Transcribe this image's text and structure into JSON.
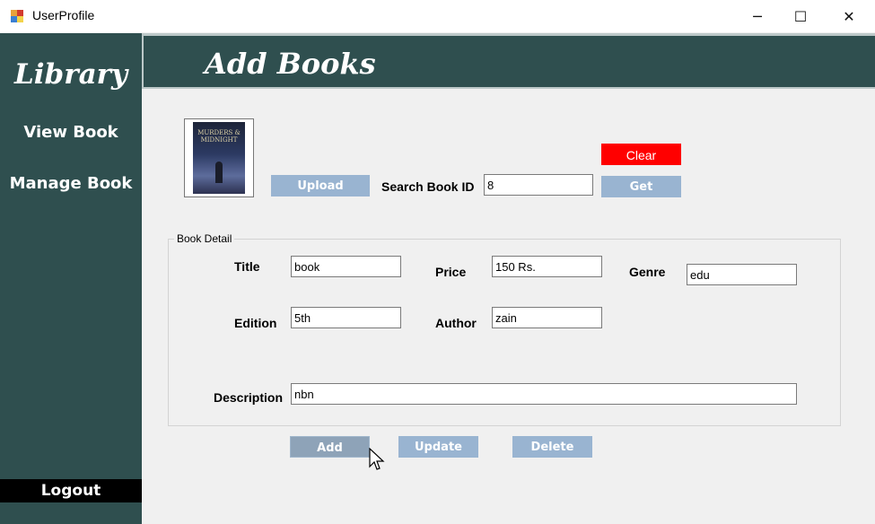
{
  "window": {
    "title": "UserProfile",
    "minimize_glyph": "─",
    "maximize_glyph": "☐",
    "close_glyph": "✕"
  },
  "sidebar": {
    "brand": "Library",
    "items": [
      {
        "label": "View Book"
      },
      {
        "label": "Manage Book"
      }
    ],
    "logout": "Logout",
    "bg_color": "#2f4f4f"
  },
  "header": {
    "title": "Add Books"
  },
  "cover": {
    "title_text": "MURDERS & MIDNIGHT"
  },
  "upload_button": "Upload",
  "search": {
    "label": "Search Book ID",
    "value": "8"
  },
  "clear_button": "Clear",
  "get_button": "Get",
  "book_detail": {
    "legend": "Book Detail",
    "title": {
      "label": "Title",
      "value": "book"
    },
    "price": {
      "label": "Price",
      "value": "150 Rs."
    },
    "genre": {
      "label": "Genre",
      "value": "edu"
    },
    "edition": {
      "label": "Edition",
      "value": "5th"
    },
    "author": {
      "label": "Author",
      "value": "zain"
    },
    "description": {
      "label": "Description",
      "value": "nbn"
    }
  },
  "actions": {
    "add": "Add",
    "update": "Update",
    "delete": "Delete"
  },
  "colors": {
    "accent_button": "#99b4d1",
    "clear_button": "#ff0000",
    "header_bg": "#2f4f4f"
  }
}
